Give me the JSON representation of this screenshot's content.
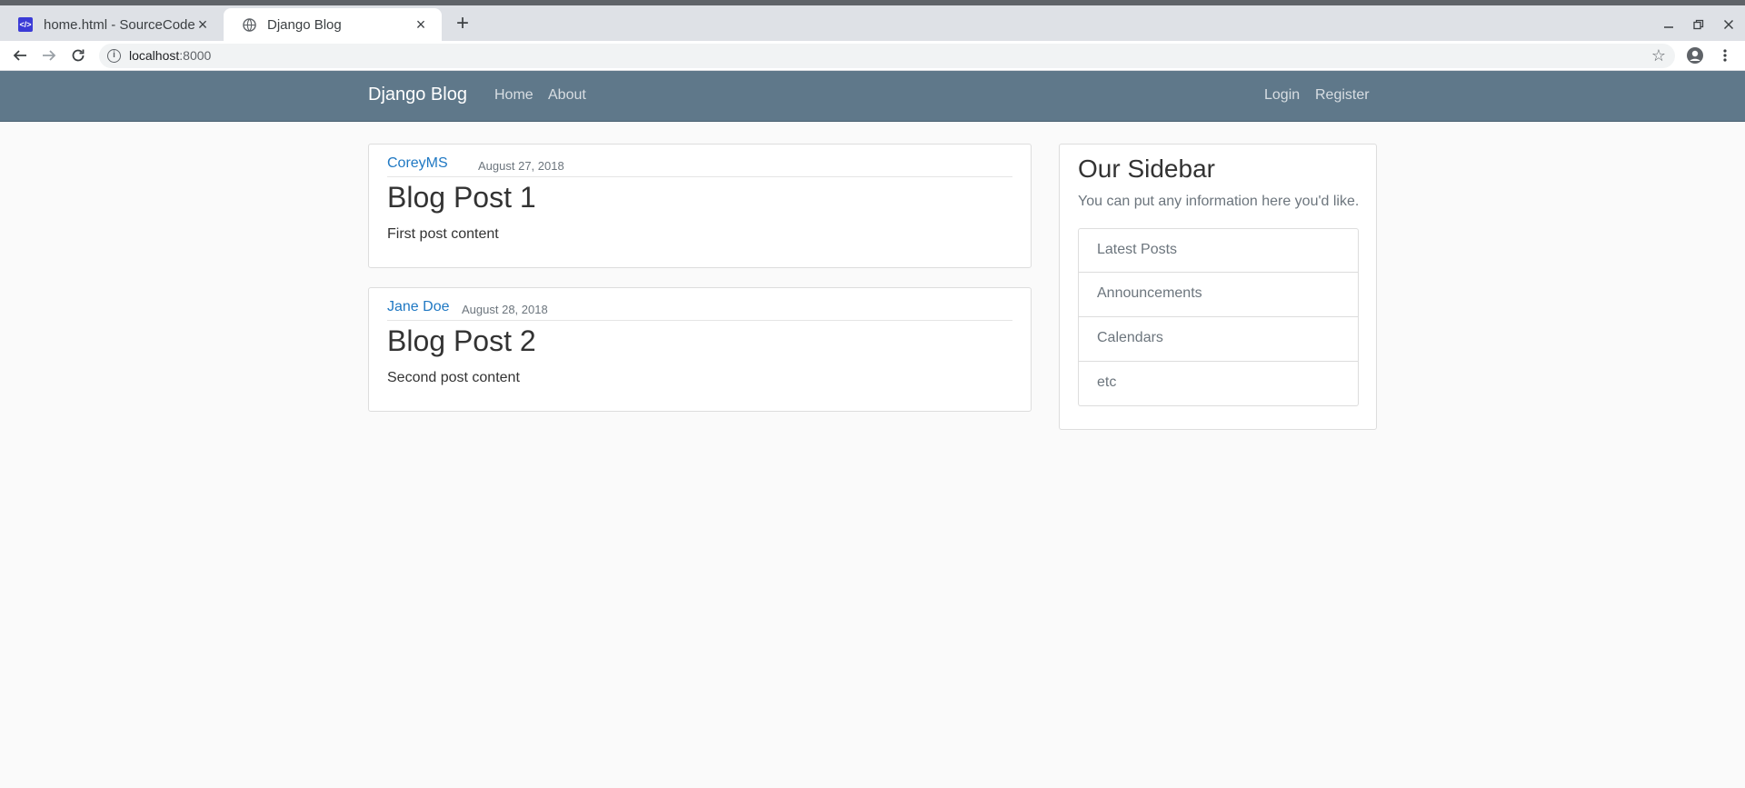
{
  "browser": {
    "tabs": [
      {
        "title": "home.html - SourceCode",
        "active": false
      },
      {
        "title": "Django Blog",
        "active": true
      }
    ],
    "url_host": "localhost",
    "url_port": ":8000"
  },
  "navbar": {
    "brand": "Django Blog",
    "left_links": [
      "Home",
      "About"
    ],
    "right_links": [
      "Login",
      "Register"
    ]
  },
  "posts": [
    {
      "author": "CoreyMS",
      "date": "August 27, 2018",
      "title": "Blog Post 1",
      "content": "First post content"
    },
    {
      "author": "Jane Doe",
      "date": "August 28, 2018",
      "title": "Blog Post 2",
      "content": "Second post content"
    }
  ],
  "sidebar": {
    "title": "Our Sidebar",
    "description": "You can put any information here you'd like.",
    "items": [
      "Latest Posts",
      "Announcements",
      "Calendars",
      "etc"
    ]
  },
  "colors": {
    "navbar_bg": "#5f788a",
    "link_blue": "#1f78c3",
    "page_bg": "#fafafa"
  },
  "icons": {
    "tab_favicon_1": "code-editor-icon",
    "tab_favicon_2": "globe-icon",
    "toolbar": [
      "back-arrow-icon",
      "forward-arrow-icon",
      "reload-icon",
      "info-icon",
      "star-icon",
      "account-icon",
      "menu-icon"
    ]
  }
}
